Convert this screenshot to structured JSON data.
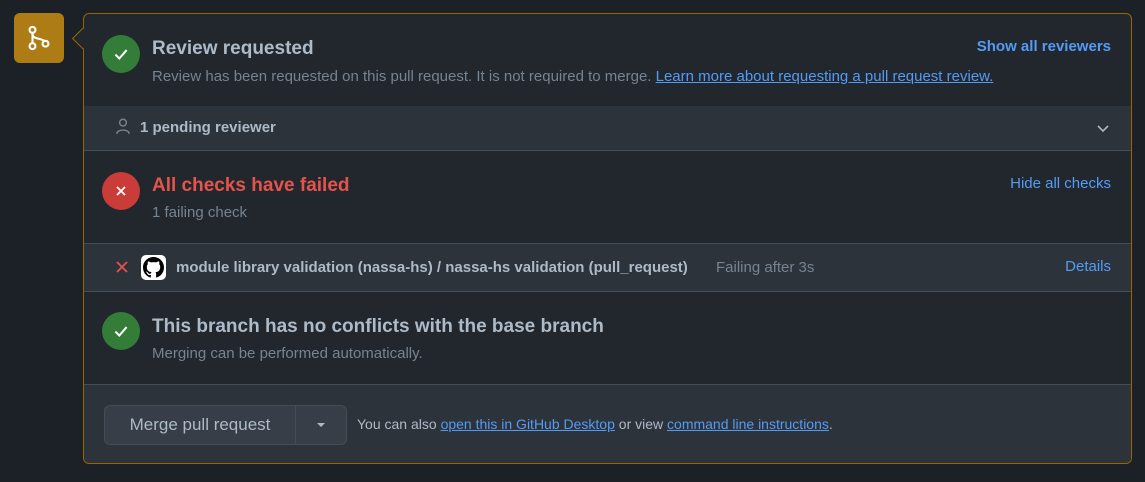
{
  "review": {
    "title": "Review requested",
    "description": "Review has been requested on this pull request. It is not required to merge.",
    "learn_more_link": "Learn more about requesting a pull request review.",
    "show_all_reviewers": "Show all reviewers",
    "pending_reviewers": "1 pending reviewer"
  },
  "checks": {
    "title": "All checks have failed",
    "subtitle": "1 failing check",
    "hide_all_checks": "Hide all checks",
    "items": [
      {
        "name": "module library validation (nassa-hs) / nassa-hs validation (pull_request)",
        "status": "Failing after 3s",
        "details_label": "Details"
      }
    ]
  },
  "conflicts": {
    "title": "This branch has no conflicts with the base branch",
    "subtitle": "Merging can be performed automatically."
  },
  "merge": {
    "button_label": "Merge pull request",
    "hint_prefix": "You can also",
    "desktop_link": "open this in GitHub Desktop",
    "hint_middle": "or view",
    "cli_link": "command line instructions",
    "hint_suffix": "."
  },
  "colors": {
    "success": "#347d39",
    "danger": "#c93c37",
    "accent_link": "#539bf5",
    "attention_border": "#966600",
    "merge_icon_bg": "#ae7c14",
    "failed_title": "#e5534b"
  }
}
